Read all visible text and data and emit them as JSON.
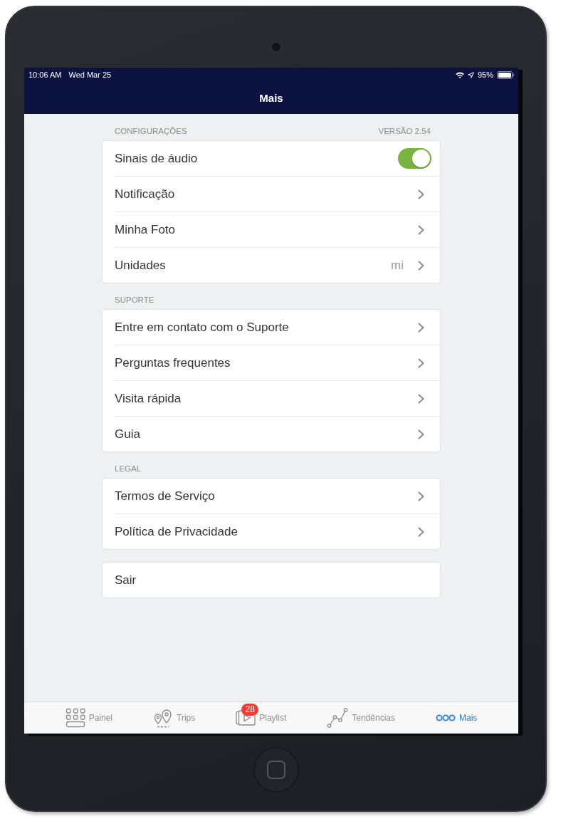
{
  "status_bar": {
    "time": "10:06 AM",
    "date": "Wed Mar 25",
    "battery": "95%"
  },
  "nav_bar": {
    "title": "Mais"
  },
  "sections": [
    {
      "header": "CONFIGURAÇÕES",
      "trailing": "VERSÃO 2.54",
      "rows": [
        {
          "kind": "toggle",
          "label": "Sinais de áudio",
          "on": true
        },
        {
          "kind": "link",
          "label": "Notificação"
        },
        {
          "kind": "link",
          "label": "Minha Foto"
        },
        {
          "kind": "link",
          "label": "Unidades",
          "value": "mi"
        }
      ]
    },
    {
      "header": "SUPORTE",
      "rows": [
        {
          "kind": "link",
          "label": "Entre em contato com o Suporte"
        },
        {
          "kind": "link",
          "label": "Perguntas frequentes"
        },
        {
          "kind": "link",
          "label": "Visita rápida"
        },
        {
          "kind": "link",
          "label": "Guia"
        }
      ]
    },
    {
      "header": "LEGAL",
      "rows": [
        {
          "kind": "link",
          "label": "Termos de Serviço"
        },
        {
          "kind": "link",
          "label": "Política de Privacidade"
        }
      ]
    },
    {
      "rows": [
        {
          "kind": "action",
          "label": "Sair"
        }
      ]
    }
  ],
  "tab_bar": {
    "tabs": [
      {
        "label": "Painel",
        "selected": false
      },
      {
        "label": "Trips",
        "selected": false
      },
      {
        "label": "Playlist",
        "badge": "28",
        "selected": false
      },
      {
        "label": "Tendências",
        "selected": false
      },
      {
        "label": "Mais",
        "selected": true
      }
    ]
  }
}
